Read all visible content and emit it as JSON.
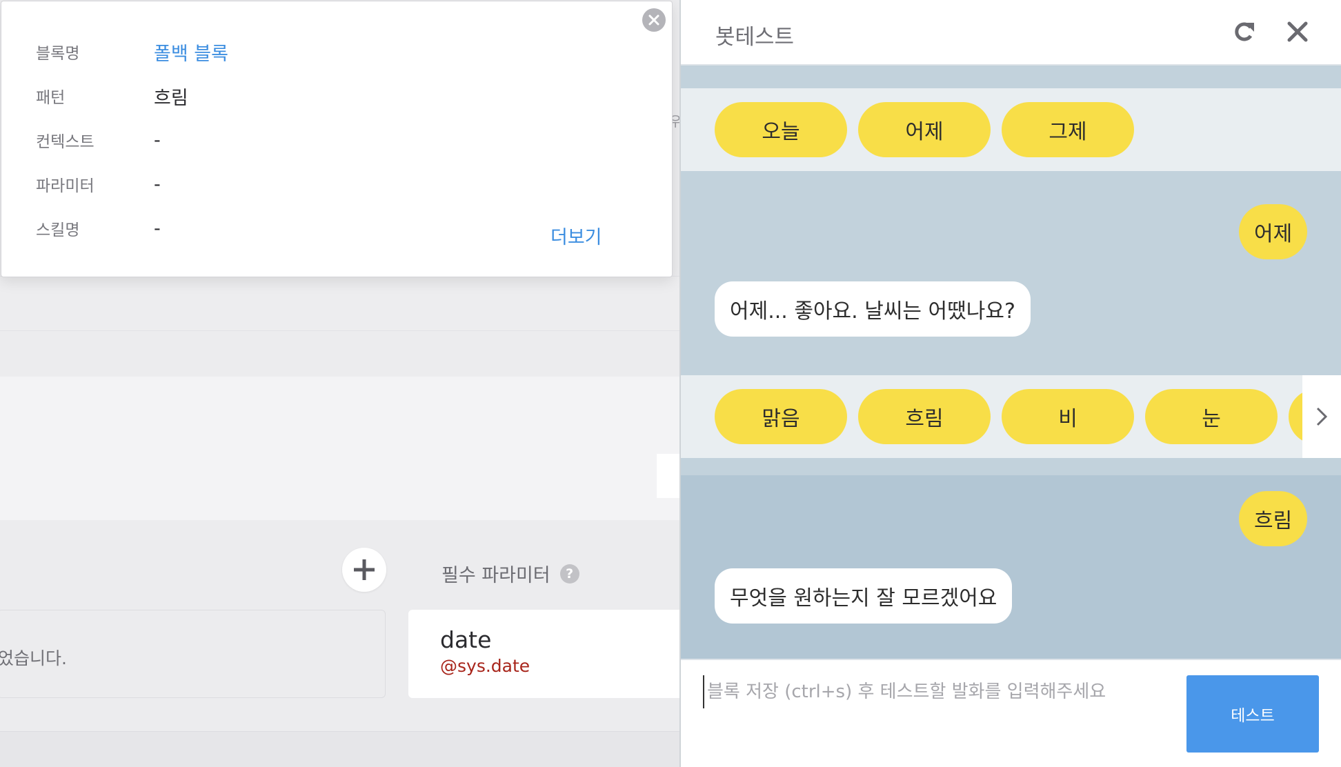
{
  "popup": {
    "rows": [
      {
        "label": "블록명",
        "value": "폴백 블록"
      },
      {
        "label": "패턴",
        "value": "흐림"
      },
      {
        "label": "컨텍스트",
        "value": "-"
      },
      {
        "label": "파라미터",
        "value": "-"
      },
      {
        "label": "스킬명",
        "value": "-"
      }
    ],
    "more_label": "더보기"
  },
  "editor": {
    "edge_glyph": "우",
    "left_input_text": "었습니다.",
    "required_params_label": "필수 파라미터",
    "help_glyph": "?",
    "param": {
      "name": "date",
      "type": "@sys.date"
    }
  },
  "bot_test": {
    "title": "봇테스트",
    "quick_replies_1": [
      "오늘",
      "어제",
      "그제"
    ],
    "user_msg_1": "어제",
    "bot_msg_1": "어제... 좋아요. 날씨는 어땠나요?",
    "quick_replies_2": [
      "맑음",
      "흐림",
      "비",
      "눈",
      ""
    ],
    "user_msg_2": "흐림",
    "bot_msg_2": "무엇을 원하는지 잘 모르겠어요",
    "input_placeholder": "블록 저장 (ctrl+s) 후 테스트할 발화를 입력해주세요",
    "test_button": "테스트"
  },
  "colors": {
    "accent_blue": "#4a97ea",
    "link_blue": "#3b8de0",
    "quick_reply_yellow": "#f8de48",
    "chat_bg": "#c2d2dc",
    "param_type_red": "#a8251b"
  },
  "icons": {
    "popup_close": "close-circle-icon",
    "refresh": "refresh-icon",
    "panel_close": "close-icon",
    "add": "plus-icon",
    "help": "question-icon",
    "next": "chevron-right-icon"
  }
}
